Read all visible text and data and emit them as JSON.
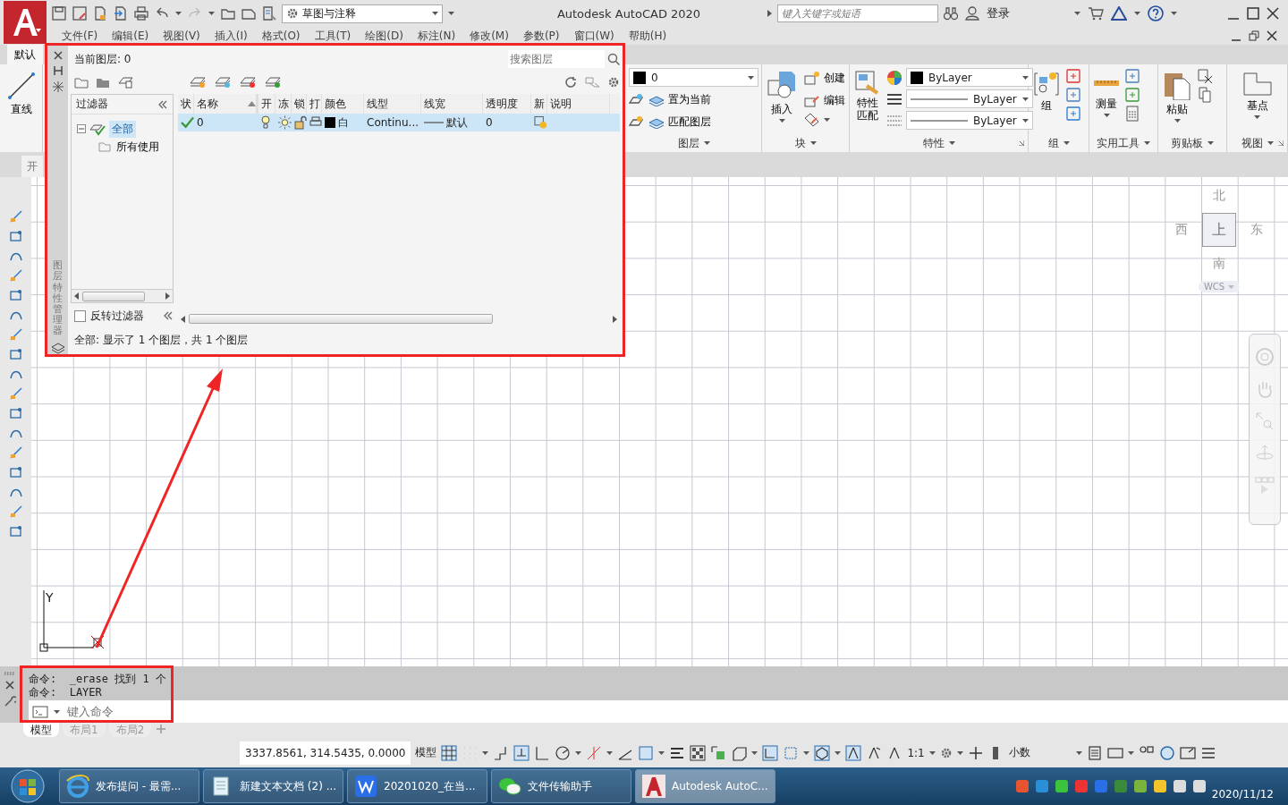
{
  "title_bar": {
    "workspace": "草图与注释",
    "title": "Autodesk AutoCAD 2020",
    "search": {
      "placeholder": "键入关键字或短语"
    },
    "sign_in": "登录"
  },
  "menu_bar": [
    "文件(F)",
    "编辑(E)",
    "视图(V)",
    "插入(I)",
    "格式(O)",
    "工具(T)",
    "绘图(D)",
    "标注(N)",
    "修改(M)",
    "参数(P)",
    "窗口(W)",
    "帮助(H)"
  ],
  "ribbon": {
    "tab": "默认",
    "draw_tool": "直线",
    "layer": {
      "current": "0",
      "color": "#000000",
      "buttons": [
        "置为当前",
        "匹配图层"
      ],
      "title": "图层"
    },
    "block": {
      "insert": "插入",
      "create": "创建",
      "edit": "编辑",
      "title": "块"
    },
    "properties": {
      "match": "特性匹配",
      "combos": [
        "ByLayer",
        "ByLayer",
        "ByLayer"
      ],
      "title": "特性"
    },
    "group": {
      "button": "组",
      "title": "组"
    },
    "utilities": {
      "button": "测量",
      "title": "实用工具"
    },
    "clipboard": {
      "button": "粘贴",
      "title": "剪贴板"
    },
    "view": {
      "button": "基点",
      "title": "视图"
    }
  },
  "file_tab": "开",
  "layer_manager": {
    "side_title": "图层特性管理器",
    "current_layer": "当前图层: 0",
    "search": {
      "placeholder": "搜索图层"
    },
    "filter_header": "过滤器",
    "filters": [
      {
        "label": "全部",
        "selected": true,
        "expanded": true,
        "children": [
          {
            "label": "所有使用",
            "selected": false
          }
        ]
      }
    ],
    "invert_filter": {
      "label": "反转过滤器",
      "checked": false
    },
    "columns": [
      "状",
      "名称",
      "开",
      "冻",
      "锁",
      "打",
      "颜色",
      "线型",
      "线宽",
      "透明度",
      "新",
      "说明"
    ],
    "rows": [
      {
        "current": true,
        "name": "0",
        "on": true,
        "frozen": false,
        "locked": false,
        "plot": true,
        "color": "#000000",
        "color_name": "白",
        "linetype": "Continu...",
        "lineweight": "默认",
        "transparency": "0",
        "selected": true
      }
    ],
    "status": "全部: 显示了 1 个图层，共 1 个图层"
  },
  "canvas": {
    "y_axis": "Y",
    "viewcube": {
      "north": "北",
      "west": "西",
      "face": "上",
      "east": "东",
      "south": "南",
      "ucs": "WCS"
    }
  },
  "command_line": {
    "history": [
      "命令:  _erase 找到 1 个",
      "命令:  LAYER"
    ],
    "placeholder": "键入命令"
  },
  "layout_tabs": [
    {
      "label": "模型",
      "selected": true
    },
    {
      "label": "布局1",
      "selected": false
    },
    {
      "label": "布局2",
      "selected": false
    }
  ],
  "status_bar": {
    "coordinates": "3337.8561, 314.5435, 0.0000",
    "space": "模型",
    "scale": "1:1",
    "units": "小数"
  },
  "taskbar": {
    "items": [
      {
        "label": "发布提问 - 最需...",
        "selected": false
      },
      {
        "label": "新建文本文档 (2) ...",
        "selected": false
      },
      {
        "label": "20201020_在当...",
        "selected": false
      },
      {
        "label": "文件传输助手",
        "selected": false
      },
      {
        "label": "Autodesk AutoC...",
        "selected": true
      }
    ],
    "date": "2020/11/12"
  }
}
